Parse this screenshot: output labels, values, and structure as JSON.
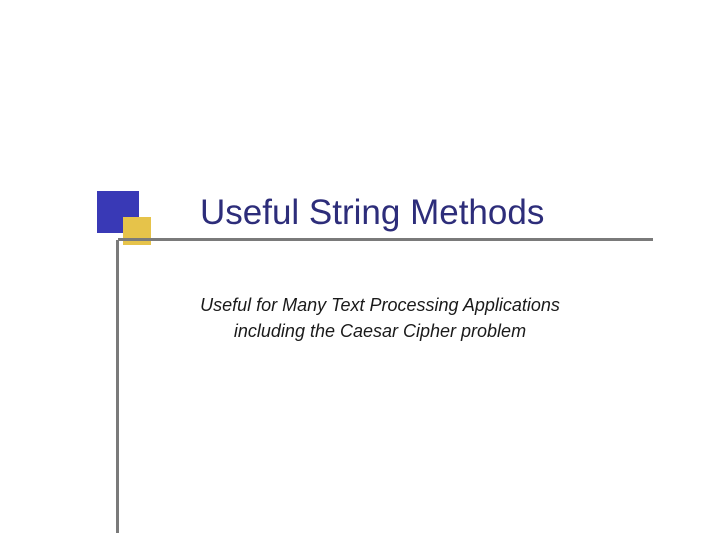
{
  "slide": {
    "title": "Useful String Methods",
    "subtitle_line1": "Useful for Many Text Processing Applications",
    "subtitle_line2": "including the Caesar Cipher problem"
  }
}
